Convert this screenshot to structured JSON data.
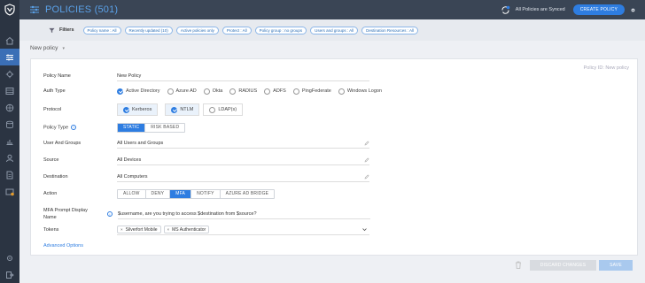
{
  "header": {
    "title": "POLICIES (501)",
    "sync_status": "All Policies are Synced",
    "create_button": "CREATE POLICY"
  },
  "filters": {
    "label": "Filters",
    "chips": [
      "Policy name : All",
      "Recently updated (10)",
      "Active policies only",
      "Protect : All",
      "Policy group : no groups",
      "Users and groups : All",
      "Destination Resources : All"
    ]
  },
  "breadcrumb": {
    "title": "New policy"
  },
  "form": {
    "policy_id": "Policy ID: New policy",
    "policy_name": {
      "label": "Policy Name",
      "value": "New Policy"
    },
    "auth_type": {
      "label": "Auth Type",
      "options": [
        "Active Directory",
        "Azure AD",
        "Okta",
        "RADIUS",
        "ADFS",
        "PingFederate",
        "Windows Logon"
      ],
      "selected": "Active Directory"
    },
    "protocol": {
      "label": "Protocol",
      "options": [
        "Kerberos",
        "NTLM",
        "LDAP(s)"
      ],
      "checked": [
        "Kerberos",
        "NTLM"
      ]
    },
    "policy_type": {
      "label": "Policy Type",
      "options": [
        "STATIC",
        "RISK BASED"
      ],
      "selected": "STATIC"
    },
    "users_groups": {
      "label": "User And Groups",
      "value": "All Users and Groups"
    },
    "source": {
      "label": "Source",
      "value": "All Devices"
    },
    "destination": {
      "label": "Destination",
      "value": "All Computers"
    },
    "action": {
      "label": "Action",
      "options": [
        "ALLOW",
        "DENY",
        "MFA",
        "NOTIFY",
        "AZURE AD BRIDGE"
      ],
      "selected": "MFA"
    },
    "mfa_prompt": {
      "label_line1": "MFA Prompt Display",
      "label_line2": "Name",
      "value": "$username, are you trying to access $destination from $source?"
    },
    "tokens": {
      "label": "Tokens",
      "values": [
        "Silverfort Mobile",
        "MS Authenticator"
      ]
    },
    "advanced_link": "Advanced Options"
  },
  "footer": {
    "discard_button": "DISCARD CHANGES",
    "save_button": "SAVE"
  },
  "colors": {
    "accent": "#2e7de1",
    "header_bg": "#3a4555",
    "sidebar_bg": "#2b3442"
  }
}
